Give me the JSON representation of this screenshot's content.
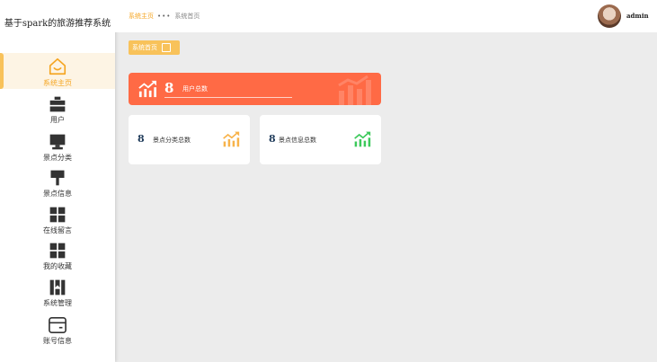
{
  "sidebar": {
    "title": "基于spark的旅游推荐系统",
    "items": [
      {
        "label": "系统主页",
        "icon": "home-icon"
      },
      {
        "label": "用户",
        "icon": "user-briefcase-icon"
      },
      {
        "label": "景点分类",
        "icon": "monitor-icon"
      },
      {
        "label": "景点信息",
        "icon": "brush-icon"
      },
      {
        "label": "在线留言",
        "icon": "grid-icon"
      },
      {
        "label": "我的收藏",
        "icon": "grid-icon"
      },
      {
        "label": "系统管理",
        "icon": "book-icon"
      },
      {
        "label": "账号信息",
        "icon": "card-icon"
      }
    ]
  },
  "header": {
    "breadcrumb_home": "系统主页",
    "breadcrumb_sep": "•••",
    "breadcrumb_current": "系统首页",
    "username": "admin"
  },
  "tags": [
    {
      "label": "系统首页"
    }
  ],
  "stats": {
    "users": {
      "value": "8",
      "label": "用户总数"
    },
    "categories": {
      "value": "8",
      "label": "景点分类总数"
    },
    "spots": {
      "value": "8",
      "label": "景点信息总数"
    }
  },
  "colors": {
    "accent": "#f5a623",
    "main_card": "#ff6a45",
    "orange_icon": "#f8b34a",
    "green_icon": "#3cc95a"
  }
}
